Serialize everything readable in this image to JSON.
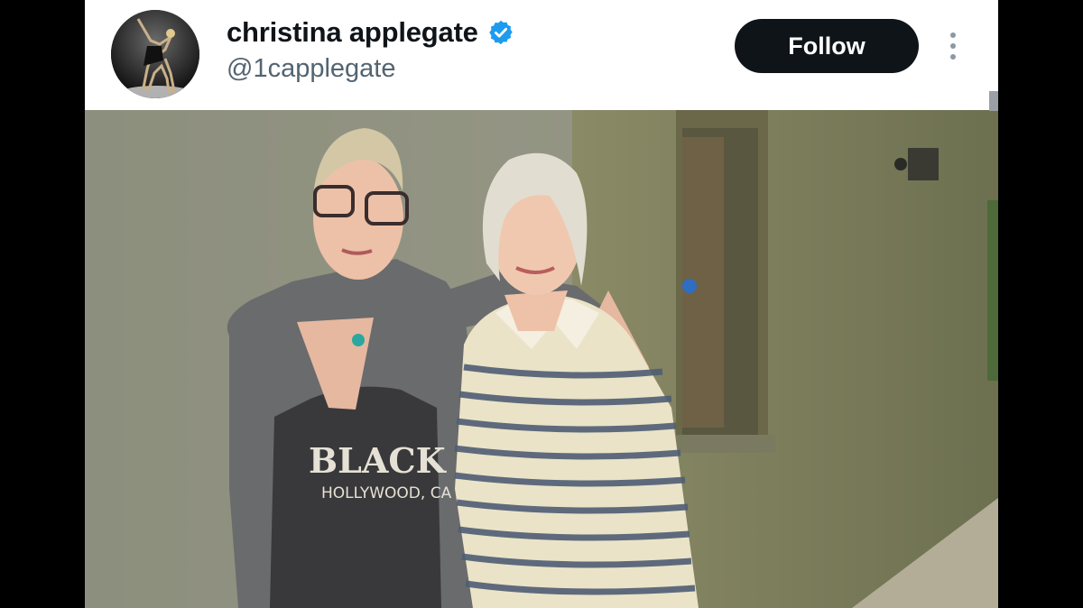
{
  "author": {
    "display_name": "christina applegate",
    "handle": "@1capplegate",
    "verified": true,
    "verified_icon": "verified-badge-icon",
    "verified_color": "#1d9bf0"
  },
  "actions": {
    "follow_label": "Follow",
    "more_icon": "more-vertical-icon"
  },
  "media": {
    "shirt_text_line1": "BLACK",
    "shirt_text_line2": "HOLLYWOOD, CA"
  },
  "colors": {
    "follow_bg": "#0f1419",
    "name_color": "#0f1419",
    "handle_color": "#536471"
  }
}
